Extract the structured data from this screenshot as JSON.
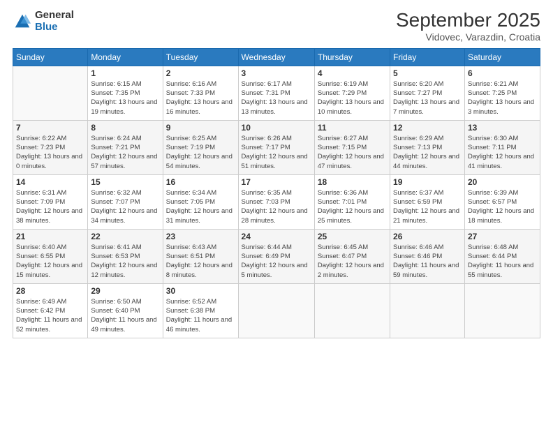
{
  "logo": {
    "general": "General",
    "blue": "Blue"
  },
  "title": "September 2025",
  "location": "Vidovec, Varazdin, Croatia",
  "weekdays": [
    "Sunday",
    "Monday",
    "Tuesday",
    "Wednesday",
    "Thursday",
    "Friday",
    "Saturday"
  ],
  "weeks": [
    [
      {
        "day": "",
        "sunrise": "",
        "sunset": "",
        "daylight": ""
      },
      {
        "day": "1",
        "sunrise": "Sunrise: 6:15 AM",
        "sunset": "Sunset: 7:35 PM",
        "daylight": "Daylight: 13 hours and 19 minutes."
      },
      {
        "day": "2",
        "sunrise": "Sunrise: 6:16 AM",
        "sunset": "Sunset: 7:33 PM",
        "daylight": "Daylight: 13 hours and 16 minutes."
      },
      {
        "day": "3",
        "sunrise": "Sunrise: 6:17 AM",
        "sunset": "Sunset: 7:31 PM",
        "daylight": "Daylight: 13 hours and 13 minutes."
      },
      {
        "day": "4",
        "sunrise": "Sunrise: 6:19 AM",
        "sunset": "Sunset: 7:29 PM",
        "daylight": "Daylight: 13 hours and 10 minutes."
      },
      {
        "day": "5",
        "sunrise": "Sunrise: 6:20 AM",
        "sunset": "Sunset: 7:27 PM",
        "daylight": "Daylight: 13 hours and 7 minutes."
      },
      {
        "day": "6",
        "sunrise": "Sunrise: 6:21 AM",
        "sunset": "Sunset: 7:25 PM",
        "daylight": "Daylight: 13 hours and 3 minutes."
      }
    ],
    [
      {
        "day": "7",
        "sunrise": "Sunrise: 6:22 AM",
        "sunset": "Sunset: 7:23 PM",
        "daylight": "Daylight: 13 hours and 0 minutes."
      },
      {
        "day": "8",
        "sunrise": "Sunrise: 6:24 AM",
        "sunset": "Sunset: 7:21 PM",
        "daylight": "Daylight: 12 hours and 57 minutes."
      },
      {
        "day": "9",
        "sunrise": "Sunrise: 6:25 AM",
        "sunset": "Sunset: 7:19 PM",
        "daylight": "Daylight: 12 hours and 54 minutes."
      },
      {
        "day": "10",
        "sunrise": "Sunrise: 6:26 AM",
        "sunset": "Sunset: 7:17 PM",
        "daylight": "Daylight: 12 hours and 51 minutes."
      },
      {
        "day": "11",
        "sunrise": "Sunrise: 6:27 AM",
        "sunset": "Sunset: 7:15 PM",
        "daylight": "Daylight: 12 hours and 47 minutes."
      },
      {
        "day": "12",
        "sunrise": "Sunrise: 6:29 AM",
        "sunset": "Sunset: 7:13 PM",
        "daylight": "Daylight: 12 hours and 44 minutes."
      },
      {
        "day": "13",
        "sunrise": "Sunrise: 6:30 AM",
        "sunset": "Sunset: 7:11 PM",
        "daylight": "Daylight: 12 hours and 41 minutes."
      }
    ],
    [
      {
        "day": "14",
        "sunrise": "Sunrise: 6:31 AM",
        "sunset": "Sunset: 7:09 PM",
        "daylight": "Daylight: 12 hours and 38 minutes."
      },
      {
        "day": "15",
        "sunrise": "Sunrise: 6:32 AM",
        "sunset": "Sunset: 7:07 PM",
        "daylight": "Daylight: 12 hours and 34 minutes."
      },
      {
        "day": "16",
        "sunrise": "Sunrise: 6:34 AM",
        "sunset": "Sunset: 7:05 PM",
        "daylight": "Daylight: 12 hours and 31 minutes."
      },
      {
        "day": "17",
        "sunrise": "Sunrise: 6:35 AM",
        "sunset": "Sunset: 7:03 PM",
        "daylight": "Daylight: 12 hours and 28 minutes."
      },
      {
        "day": "18",
        "sunrise": "Sunrise: 6:36 AM",
        "sunset": "Sunset: 7:01 PM",
        "daylight": "Daylight: 12 hours and 25 minutes."
      },
      {
        "day": "19",
        "sunrise": "Sunrise: 6:37 AM",
        "sunset": "Sunset: 6:59 PM",
        "daylight": "Daylight: 12 hours and 21 minutes."
      },
      {
        "day": "20",
        "sunrise": "Sunrise: 6:39 AM",
        "sunset": "Sunset: 6:57 PM",
        "daylight": "Daylight: 12 hours and 18 minutes."
      }
    ],
    [
      {
        "day": "21",
        "sunrise": "Sunrise: 6:40 AM",
        "sunset": "Sunset: 6:55 PM",
        "daylight": "Daylight: 12 hours and 15 minutes."
      },
      {
        "day": "22",
        "sunrise": "Sunrise: 6:41 AM",
        "sunset": "Sunset: 6:53 PM",
        "daylight": "Daylight: 12 hours and 12 minutes."
      },
      {
        "day": "23",
        "sunrise": "Sunrise: 6:43 AM",
        "sunset": "Sunset: 6:51 PM",
        "daylight": "Daylight: 12 hours and 8 minutes."
      },
      {
        "day": "24",
        "sunrise": "Sunrise: 6:44 AM",
        "sunset": "Sunset: 6:49 PM",
        "daylight": "Daylight: 12 hours and 5 minutes."
      },
      {
        "day": "25",
        "sunrise": "Sunrise: 6:45 AM",
        "sunset": "Sunset: 6:47 PM",
        "daylight": "Daylight: 12 hours and 2 minutes."
      },
      {
        "day": "26",
        "sunrise": "Sunrise: 6:46 AM",
        "sunset": "Sunset: 6:46 PM",
        "daylight": "Daylight: 11 hours and 59 minutes."
      },
      {
        "day": "27",
        "sunrise": "Sunrise: 6:48 AM",
        "sunset": "Sunset: 6:44 PM",
        "daylight": "Daylight: 11 hours and 55 minutes."
      }
    ],
    [
      {
        "day": "28",
        "sunrise": "Sunrise: 6:49 AM",
        "sunset": "Sunset: 6:42 PM",
        "daylight": "Daylight: 11 hours and 52 minutes."
      },
      {
        "day": "29",
        "sunrise": "Sunrise: 6:50 AM",
        "sunset": "Sunset: 6:40 PM",
        "daylight": "Daylight: 11 hours and 49 minutes."
      },
      {
        "day": "30",
        "sunrise": "Sunrise: 6:52 AM",
        "sunset": "Sunset: 6:38 PM",
        "daylight": "Daylight: 11 hours and 46 minutes."
      },
      {
        "day": "",
        "sunrise": "",
        "sunset": "",
        "daylight": ""
      },
      {
        "day": "",
        "sunrise": "",
        "sunset": "",
        "daylight": ""
      },
      {
        "day": "",
        "sunrise": "",
        "sunset": "",
        "daylight": ""
      },
      {
        "day": "",
        "sunrise": "",
        "sunset": "",
        "daylight": ""
      }
    ]
  ]
}
